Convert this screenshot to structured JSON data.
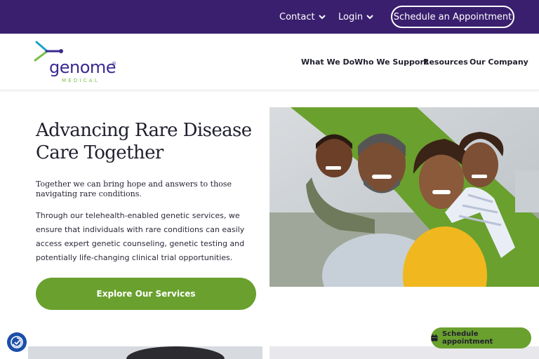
{
  "topbar": {
    "contact_label": "Contact",
    "login_label": "Login",
    "schedule_label": "Schedule an Appointment",
    "bg_color": "#3a1f6e"
  },
  "logo": {
    "word": "genome",
    "sub": "MEDICAL",
    "reg": "®"
  },
  "nav": {
    "items": [
      "What We Do",
      "Who We Support",
      "Resources",
      "Our Company"
    ]
  },
  "hero": {
    "title": "Advancing Rare Disease Care Together",
    "lead": "Together we can bring hope and answers to those navigating rare conditions.",
    "body": "Through our telehealth-enabled genetic services, we ensure that individuals with rare conditions can easily access expert genetic counseling, genetic testing and potentially life-changing clinical trial opportunities.",
    "cta_label": "Explore Our Services",
    "accent_color": "#6aa02e"
  },
  "floating": {
    "schedule_label": "Schedule appointment",
    "calendar_icon": "calendar-icon",
    "accessibility_icon": "accessibility-icon"
  }
}
